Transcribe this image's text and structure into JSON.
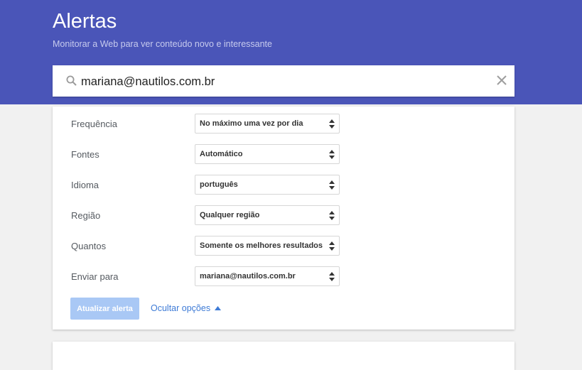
{
  "header": {
    "title": "Alertas",
    "subtitle": "Monitorar a Web para ver conteúdo novo e interessante",
    "background_color": "#4a55b8"
  },
  "search": {
    "icon": "search-icon",
    "value": "mariana@nautilos.com.br",
    "clear_icon": "close-icon"
  },
  "options": {
    "rows": [
      {
        "label": "Frequência",
        "selected": "No máximo uma vez por dia"
      },
      {
        "label": "Fontes",
        "selected": "Automático"
      },
      {
        "label": "Idioma",
        "selected": "português"
      },
      {
        "label": "Região",
        "selected": "Qualquer região"
      },
      {
        "label": "Quantos",
        "selected": "Somente os melhores resultados"
      },
      {
        "label": "Enviar para",
        "selected": "mariana@nautilos.com.br"
      }
    ],
    "update_button": "Atualizar alerta",
    "hide_options_link": "Ocultar opções",
    "accent_color": "#3e7bd6",
    "button_color": "#a9c8f5"
  }
}
